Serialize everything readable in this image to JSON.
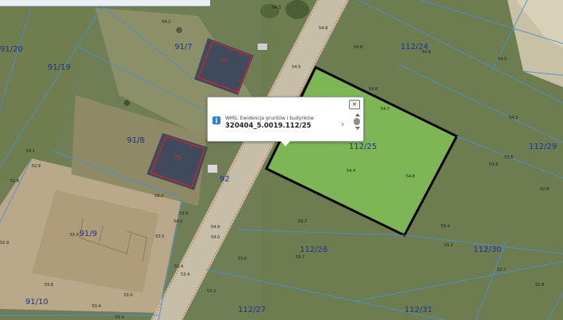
{
  "popup": {
    "close_label": "✕",
    "info_icon_label": "i",
    "source": "WMS, Ewidencja gruntów i budynków",
    "parcel_id": "320404_5.0019.112/25",
    "chevron": "›"
  },
  "parcels": {
    "p91_20": "91/20",
    "p91_7": "91/7",
    "p91_19": "91/19",
    "p91_8": "91/8",
    "p91_9": "91/9",
    "p91_10": "91/10",
    "p92": "92",
    "p112_24": "112/24",
    "p112_25": "112/25",
    "p112_29": "112/29",
    "p112_26": "112/26",
    "p112_30": "112/30",
    "p112_27": "112/27",
    "p112_31": "112/31"
  },
  "building_labels": {
    "b1": "m",
    "b2": "m"
  },
  "elevations": {
    "e1": "54.2",
    "e2": "54.3",
    "e3": "54.8",
    "e4": "54.5",
    "e5": "54.8",
    "e6": "54.9",
    "e7": "54.8",
    "e8": "54.7",
    "e9": "54.5",
    "e10": "54.3",
    "e11": "54.4",
    "e12": "54.8",
    "e13": "53.8",
    "e14": "53.6",
    "e15": "53.4",
    "e16": "52.8",
    "e17": "53.2",
    "e18": "52.7",
    "e19": "52.8",
    "e20": "54.9",
    "e21": "54.0",
    "e22": "53.8",
    "e23": "54.0",
    "e24": "54.0",
    "e25": "53.7",
    "e26": "53.6",
    "e27": "53.7",
    "e28": "53.4",
    "e29": "53.2",
    "e30": "53.4",
    "e31": "53.5",
    "e32": "53.4",
    "e33": "53.8",
    "e34": "52.9",
    "e35": "53.1",
    "e36": "52.8",
    "e37": "53.4",
    "e38": "52.9",
    "e39": "53.0",
    "e40": "53.4"
  },
  "colors": {
    "selection_outline": "#000000",
    "selection_fill": "#8ee65a",
    "parcel_lines": "#4a8fd6",
    "parcel_labels": "#1f2f9a",
    "building_outline": "#e02020"
  }
}
